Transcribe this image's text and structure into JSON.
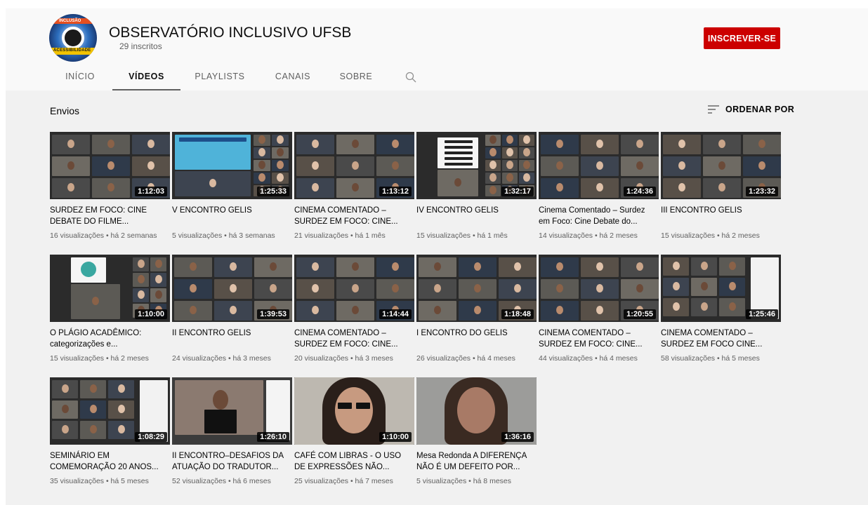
{
  "channel": {
    "name": "OBSERVATÓRIO INCLUSIVO UFSB",
    "subscribers": "29 inscritos",
    "subscribe_label": "INSCREVER-SE",
    "avatar_text_top": "INCLUSÃO",
    "avatar_text_bottom": "ACESSIBILIDADE"
  },
  "tabs": [
    {
      "label": "INÍCIO",
      "active": false
    },
    {
      "label": "VÍDEOS",
      "active": true
    },
    {
      "label": "PLAYLISTS",
      "active": false
    },
    {
      "label": "CANAIS",
      "active": false
    },
    {
      "label": "SOBRE",
      "active": false
    }
  ],
  "section": {
    "title": "Envios",
    "sort_label": "ORDENAR POR"
  },
  "colors": {
    "subscribe": "#cc0000",
    "background": "#f1f1f1",
    "header": "#f9f9f9"
  },
  "videos": [
    {
      "title": "SURDEZ EM FOCO: CINE DEBATE DO FILME...",
      "meta": "16 visualizações • há 2 semanas",
      "duration": "1:12:03",
      "style": "grid6"
    },
    {
      "title": "V ENCONTRO GELIS",
      "meta": "5 visualizações • há 3 semanas",
      "duration": "1:25:33",
      "style": "slide"
    },
    {
      "title": "CINEMA COMENTADO – SURDEZ EM FOCO: CINE...",
      "meta": "21 visualizações • há 1 mês",
      "duration": "1:13:12",
      "style": "grid9"
    },
    {
      "title": "IV ENCONTRO GELIS",
      "meta": "15 visualizações • há 1 mês",
      "duration": "1:32:17",
      "style": "doc"
    },
    {
      "title": "Cinema Comentado – Surdez em Foco: Cine Debate do...",
      "meta": "14 visualizações • há 2 meses",
      "duration": "1:24:36",
      "style": "grid9"
    },
    {
      "title": "III ENCONTRO GELIS",
      "meta": "15 visualizações • há 2 meses",
      "duration": "1:23:32",
      "style": "grid9"
    },
    {
      "title": "O PLÁGIO ACADÊMICO: categorizações e...",
      "meta": "15 visualizações • há 2 meses",
      "duration": "1:10:00",
      "style": "slide2"
    },
    {
      "title": "II ENCONTRO GELIS",
      "meta": "24 visualizações • há 3 meses",
      "duration": "1:39:53",
      "style": "grid9"
    },
    {
      "title": "CINEMA COMENTADO – SURDEZ EM FOCO: CINE...",
      "meta": "20 visualizações • há 3 meses",
      "duration": "1:14:44",
      "style": "grid9"
    },
    {
      "title": "I ENCONTRO DO GELIS",
      "meta": "26 visualizações • há 4 meses",
      "duration": "1:18:48",
      "style": "grid9"
    },
    {
      "title": "CINEMA COMENTADO – SURDEZ EM FOCO: CINE...",
      "meta": "44 visualizações • há 4 meses",
      "duration": "1:20:55",
      "style": "grid9"
    },
    {
      "title": "CINEMA COMENTADO – SURDEZ EM FOCO CINE...",
      "meta": "58 visualizações • há 5 meses",
      "duration": "1:25:46",
      "style": "gridside"
    },
    {
      "title": "SEMINÁRIO EM COMEMORAÇÃO 20 ANOS...",
      "meta": "35 visualizações • há 5 meses",
      "duration": "1:08:29",
      "style": "gridside"
    },
    {
      "title": "II ENCONTRO–DESAFIOS DA ATUAÇÃO DO TRADUTOR...",
      "meta": "52 visualizações • há 6 meses",
      "duration": "1:26:10",
      "style": "speaker"
    },
    {
      "title": "CAFÉ COM LIBRAS - O USO DE EXPRESSÕES NÃO...",
      "meta": "25 visualizações • há 7 meses",
      "duration": "1:10:00",
      "style": "face"
    },
    {
      "title": "Mesa Redonda A DIFERENÇA NÃO É UM DEFEITO POR...",
      "meta": "5 visualizações • há 8 meses",
      "duration": "1:36:16",
      "style": "face2"
    }
  ]
}
